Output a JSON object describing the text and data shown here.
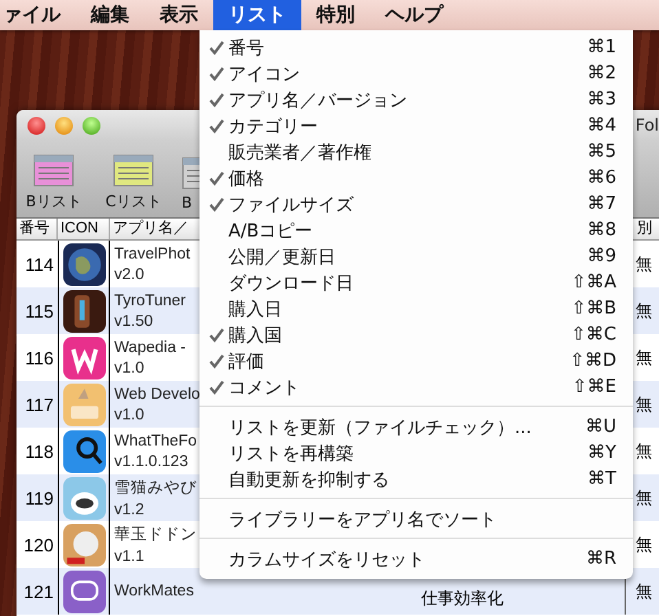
{
  "menubar": {
    "items": [
      {
        "label": "ァイル",
        "selected": false
      },
      {
        "label": "編集",
        "selected": false
      },
      {
        "label": "表示",
        "selected": false
      },
      {
        "label": "リスト",
        "selected": true
      },
      {
        "label": "特別",
        "selected": false
      },
      {
        "label": "ヘルプ",
        "selected": false
      }
    ]
  },
  "window": {
    "title_fragment": "Fol",
    "toolbar": [
      {
        "label": "Bリスト",
        "color": "#e890d8"
      },
      {
        "label": "Cリスト",
        "color": "#e0e880"
      },
      {
        "label": "B",
        "color": "#d0d0d0"
      }
    ]
  },
  "table": {
    "columns": [
      {
        "label": "番号"
      },
      {
        "label": "ICON"
      },
      {
        "label": "アプリ名／"
      },
      {},
      {
        "label": "別"
      }
    ],
    "rows": [
      {
        "number": "114",
        "kind": "globe",
        "name": "TravelPhot",
        "version": "v2.0",
        "price": "無"
      },
      {
        "number": "115",
        "kind": "guitar",
        "name": "TyroTuner",
        "version": "v1.50",
        "price": "無"
      },
      {
        "number": "116",
        "kind": "letter",
        "name": "Wapedia - ",
        "version": "v1.0",
        "price": "無"
      },
      {
        "number": "117",
        "kind": "dev",
        "name": "Web Develo",
        "version": "v1.0",
        "price": "無"
      },
      {
        "number": "118",
        "kind": "magnifier",
        "name": "WhatTheFo",
        "version": "v1.1.0.123",
        "price": "無"
      },
      {
        "number": "119",
        "kind": "cat",
        "name": "雪猫みやび",
        "version": "v1.2",
        "price": "無"
      },
      {
        "number": "120",
        "kind": "dog",
        "name": "華玉ドドン",
        "version": "v1.1",
        "price": "無"
      },
      {
        "number": "121",
        "kind": "chat",
        "name": "WorkMates",
        "category": "仕事効率化",
        "price": "無"
      }
    ]
  },
  "menu": {
    "items": [
      {
        "kind": "item",
        "label": "番号",
        "shortcut": "⌘1",
        "checked": true
      },
      {
        "kind": "item",
        "label": "アイコン",
        "shortcut": "⌘2",
        "checked": true
      },
      {
        "kind": "item",
        "label": "アプリ名／バージョン",
        "shortcut": "⌘3",
        "checked": true
      },
      {
        "kind": "item",
        "label": "カテゴリー",
        "shortcut": "⌘4",
        "checked": true
      },
      {
        "kind": "item",
        "label": "販売業者／著作権",
        "shortcut": "⌘5",
        "checked": false
      },
      {
        "kind": "item",
        "label": "価格",
        "shortcut": "⌘6",
        "checked": true
      },
      {
        "kind": "item",
        "label": "ファイルサイズ",
        "shortcut": "⌘7",
        "checked": true
      },
      {
        "kind": "item",
        "label": "A/Bコピー",
        "shortcut": "⌘8",
        "checked": false
      },
      {
        "kind": "item",
        "label": "公開／更新日",
        "shortcut": "⌘9",
        "checked": false
      },
      {
        "kind": "item",
        "label": "ダウンロード日",
        "shortcut": "⇧⌘A",
        "checked": false
      },
      {
        "kind": "item",
        "label": "購入日",
        "shortcut": "⇧⌘B",
        "checked": false
      },
      {
        "kind": "item",
        "label": "購入国",
        "shortcut": "⇧⌘C",
        "checked": true
      },
      {
        "kind": "item",
        "label": "評価",
        "shortcut": "⇧⌘D",
        "checked": true
      },
      {
        "kind": "item",
        "label": "コメント",
        "shortcut": "⇧⌘E",
        "checked": true
      },
      {
        "kind": "separator"
      },
      {
        "kind": "item",
        "label": "リストを更新（ファイルチェック）...",
        "shortcut": "⌘U",
        "checked": false
      },
      {
        "kind": "item",
        "label": "リストを再構築",
        "shortcut": "⌘Y",
        "checked": false
      },
      {
        "kind": "item",
        "label": "自動更新を抑制する",
        "shortcut": "⌘T",
        "checked": false
      },
      {
        "kind": "separator"
      },
      {
        "kind": "item",
        "label": "ライブラリーをアプリ名でソート",
        "checked": false
      },
      {
        "kind": "separator"
      },
      {
        "kind": "item",
        "label": "カラムサイズをリセット",
        "shortcut": "⌘R",
        "checked": false
      }
    ]
  }
}
